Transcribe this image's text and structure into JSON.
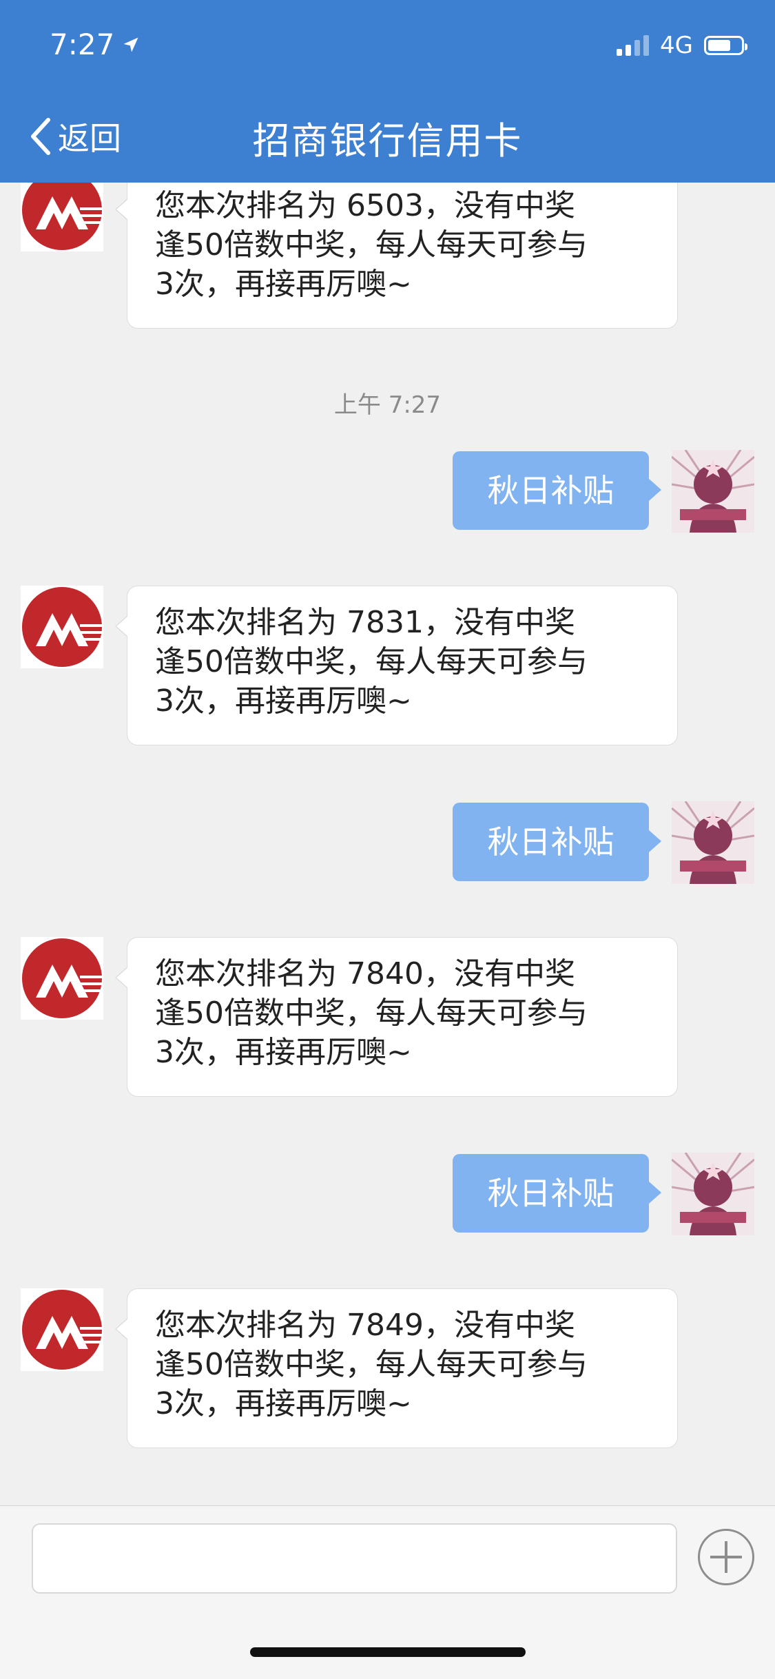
{
  "status_bar": {
    "time": "7:27",
    "network": "4G"
  },
  "nav": {
    "back_label": "返回",
    "title": "招商银行信用卡"
  },
  "thread": {
    "timestamp": "上午 7:27",
    "incoming_top": {
      "lines": [
        "您本次排名为 6503，没有中奖",
        "逢50倍数中奖，每人每天可参与",
        "3次，再接再厉噢~"
      ]
    },
    "exchanges": [
      {
        "sent": "秋日补贴",
        "reply": {
          "lines": [
            "您本次排名为 7831，没有中奖",
            "逢50倍数中奖，每人每天可参与",
            "3次，再接再厉噢~"
          ]
        }
      },
      {
        "sent": "秋日补贴",
        "reply": {
          "lines": [
            "您本次排名为 7840，没有中奖",
            "逢50倍数中奖，每人每天可参与",
            "3次，再接再厉噢~"
          ]
        }
      },
      {
        "sent": "秋日补贴",
        "reply": {
          "lines": [
            "您本次排名为 7849，没有中奖",
            "逢50倍数中奖，每人每天可参与",
            "3次，再接再厉噢~"
          ]
        }
      }
    ]
  },
  "input": {
    "placeholder": "",
    "value": ""
  },
  "colors": {
    "header": "#3d7fd0",
    "sent_bubble": "#80b3ef",
    "bank_red": "#c0282c"
  }
}
